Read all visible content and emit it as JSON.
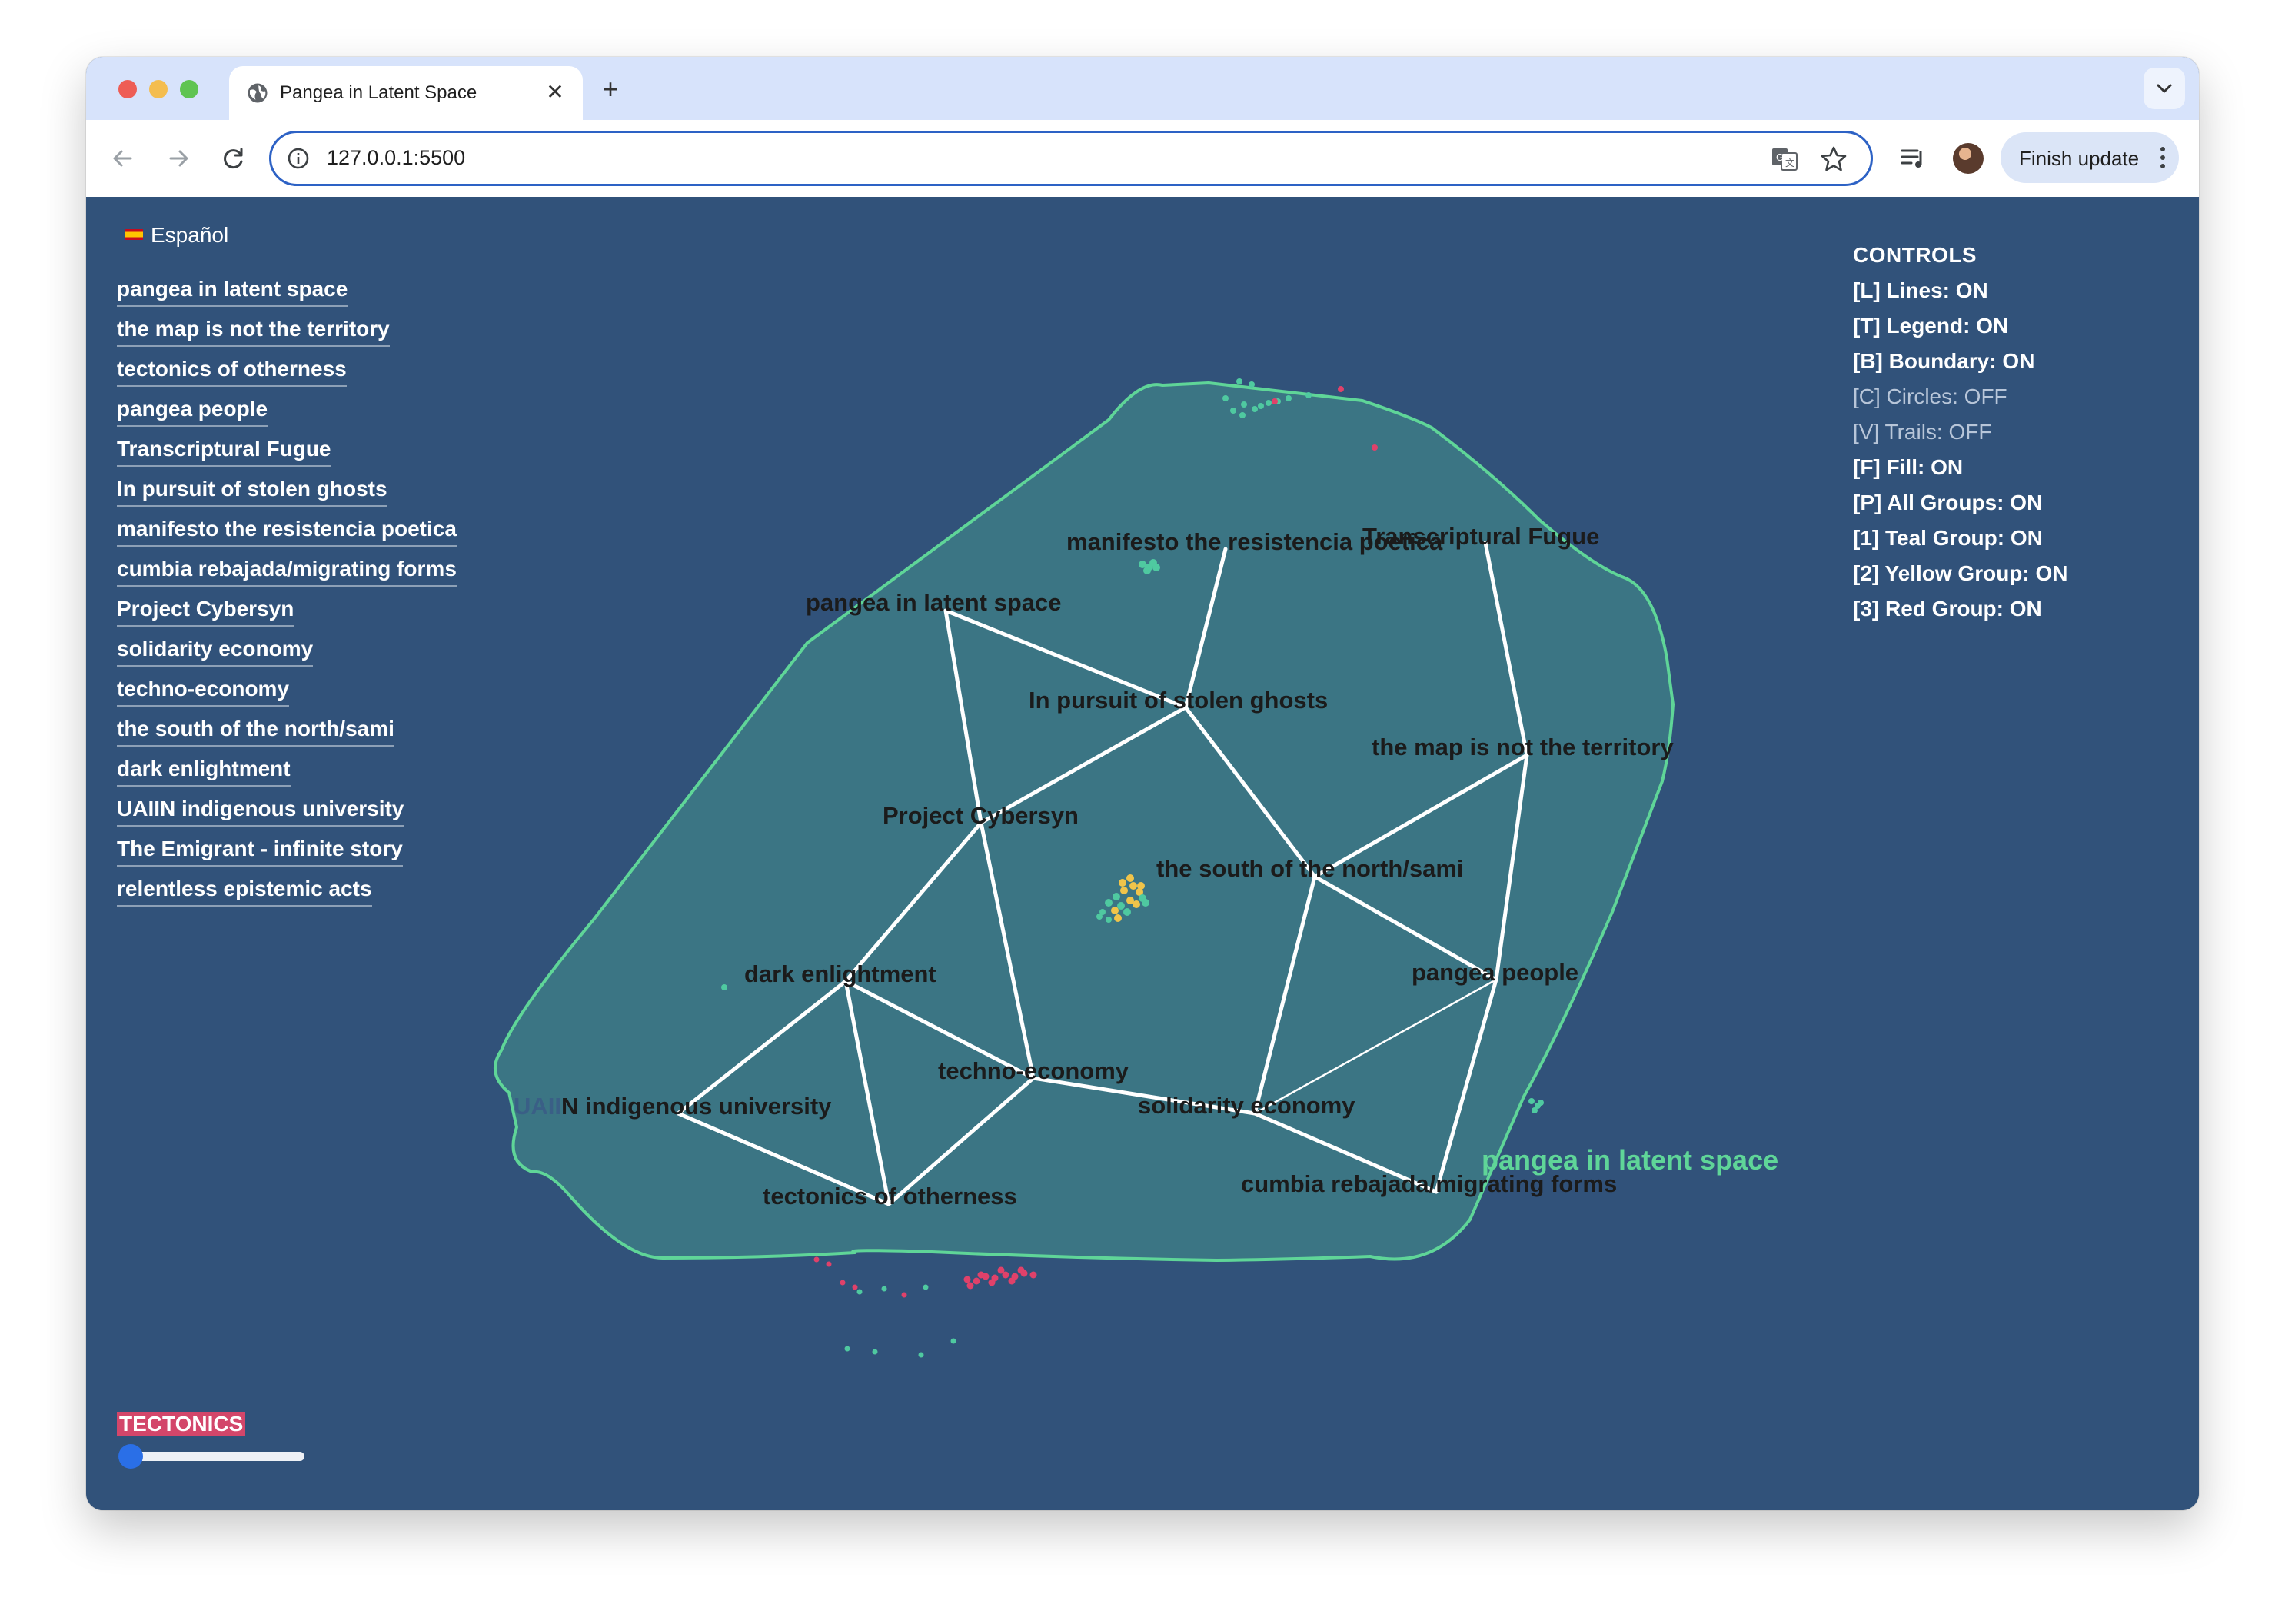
{
  "browser": {
    "tab_title": "Pangea in Latent Space",
    "url": "127.0.0.1:5500",
    "finish_update_label": "Finish update",
    "new_tab_symbol": "+",
    "close_symbol": "✕"
  },
  "language_toggle": {
    "label": "Español",
    "flag": "spain-flag-icon"
  },
  "nav_links": [
    "pangea in latent space",
    "the map is not the territory",
    "tectonics of otherness",
    "pangea people",
    "Transcriptural Fugue",
    "In pursuit of stolen ghosts",
    "manifesto the resistencia poetica",
    "cumbia rebajada/migrating forms",
    "Project Cybersyn",
    "solidarity economy",
    "techno-economy",
    "the south of the north/sami",
    "dark enlightment",
    "UAIIN indigenous university",
    "The Emigrant - infinite story",
    "relentless epistemic acts"
  ],
  "controls": {
    "title": "CONTROLS",
    "items": [
      {
        "text": "[L] Lines: ON",
        "on": true
      },
      {
        "text": "[T] Legend: ON",
        "on": true
      },
      {
        "text": "[B] Boundary: ON",
        "on": true
      },
      {
        "text": "[C] Circles: OFF",
        "on": false
      },
      {
        "text": "[V] Trails: OFF",
        "on": false
      },
      {
        "text": "[F] Fill: ON",
        "on": true
      },
      {
        "text": "[P] All Groups: ON",
        "on": true
      },
      {
        "text": "[1] Teal Group: ON",
        "on": true
      },
      {
        "text": "[2] Yellow Group: ON",
        "on": true
      },
      {
        "text": "[3] Red Group: ON",
        "on": true
      }
    ]
  },
  "graph": {
    "boundary_label": "pangea in latent space",
    "colors": {
      "boundary": "#5fd598",
      "fill": "#3d7b86",
      "edge": "#ffffff",
      "node_label": "#1b1b1b",
      "teal_dot": "#4fc9a0",
      "yellow_dot": "#f0c44a",
      "red_dot": "#e0416a"
    },
    "nodes": [
      {
        "id": "manifesto",
        "label": "manifesto the resistencia poetica"
      },
      {
        "id": "fugue",
        "label": "Transcriptural Fugue"
      },
      {
        "id": "pangea",
        "label": "pangea in latent space"
      },
      {
        "id": "ghosts",
        "label": "In pursuit of stolen ghosts"
      },
      {
        "id": "map",
        "label": "the map is not the territory"
      },
      {
        "id": "cybersyn",
        "label": "Project Cybersyn"
      },
      {
        "id": "south",
        "label": "the south of the north/sami"
      },
      {
        "id": "dark",
        "label": "dark enlightment"
      },
      {
        "id": "people",
        "label": "pangea people"
      },
      {
        "id": "techno",
        "label": "techno-economy"
      },
      {
        "id": "uaiin",
        "label": "UAIIN indigenous university"
      },
      {
        "id": "solidarity",
        "label": "solidarity economy"
      },
      {
        "id": "tectonics",
        "label": "tectonics of otherness"
      },
      {
        "id": "cumbia",
        "label": "cumbia rebajada/migrating forms"
      }
    ],
    "edges": [
      [
        "pangea",
        "cybersyn"
      ],
      [
        "pangea",
        "ghosts"
      ],
      [
        "ghosts",
        "cybersyn"
      ],
      [
        "ghosts",
        "manifesto"
      ],
      [
        "ghosts",
        "south"
      ],
      [
        "fugue",
        "map"
      ],
      [
        "map",
        "south"
      ],
      [
        "map",
        "people"
      ],
      [
        "south",
        "people"
      ],
      [
        "south",
        "solidarity"
      ],
      [
        "cybersyn",
        "dark"
      ],
      [
        "cybersyn",
        "techno"
      ],
      [
        "dark",
        "techno"
      ],
      [
        "dark",
        "uaiin"
      ],
      [
        "dark",
        "tectonics"
      ],
      [
        "uaiin",
        "tectonics"
      ],
      [
        "techno",
        "tectonics"
      ],
      [
        "techno",
        "solidarity"
      ],
      [
        "solidarity",
        "people"
      ],
      [
        "solidarity",
        "cumbia"
      ],
      [
        "people",
        "cumbia"
      ]
    ]
  },
  "tectonics": {
    "label": "TECTONICS",
    "value": 0
  }
}
